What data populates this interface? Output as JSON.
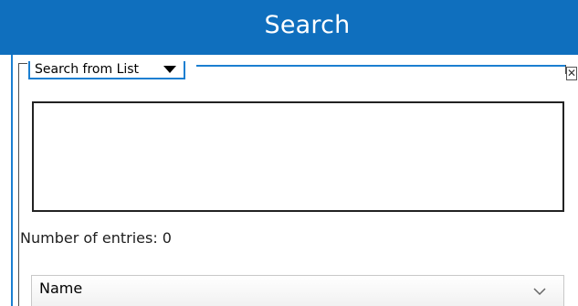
{
  "window": {
    "title": "Search"
  },
  "search_panel": {
    "mode_label": "Search from List",
    "close_label": "✕"
  },
  "results": {
    "count_label": "Number of entries: 0"
  },
  "field_select": {
    "selected_value": "Name"
  },
  "colors": {
    "title_bar": "#0f6fbe",
    "accent_blue": "#1b7fd1",
    "frame_line": "#4d4d4d"
  },
  "icons": {
    "mode_dropdown": "caret-icon",
    "close": "close-icon",
    "field_dropdown": "chevron-down-icon"
  }
}
